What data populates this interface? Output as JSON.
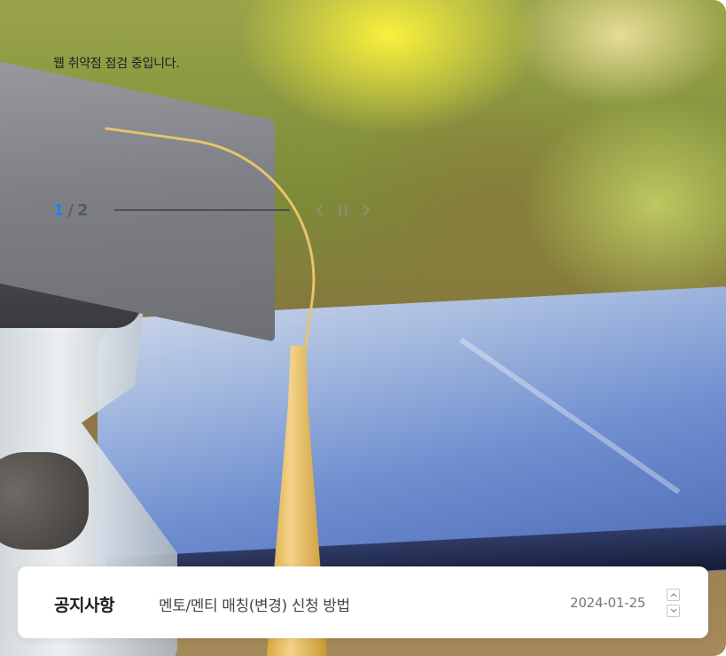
{
  "hero": {
    "status_message": "웹 취약점 점검 중입니다."
  },
  "pager": {
    "current": "1",
    "separator": "/",
    "total": "2",
    "icons": [
      "chevron-left-icon",
      "pause-icon",
      "chevron-right-icon"
    ]
  },
  "notice": {
    "label": "공지사항",
    "title": "멘토/멘티 매칭(변경) 신청 방법",
    "date": "2024-01-25",
    "icons": [
      "chevron-up-icon",
      "chevron-down-icon"
    ]
  }
}
